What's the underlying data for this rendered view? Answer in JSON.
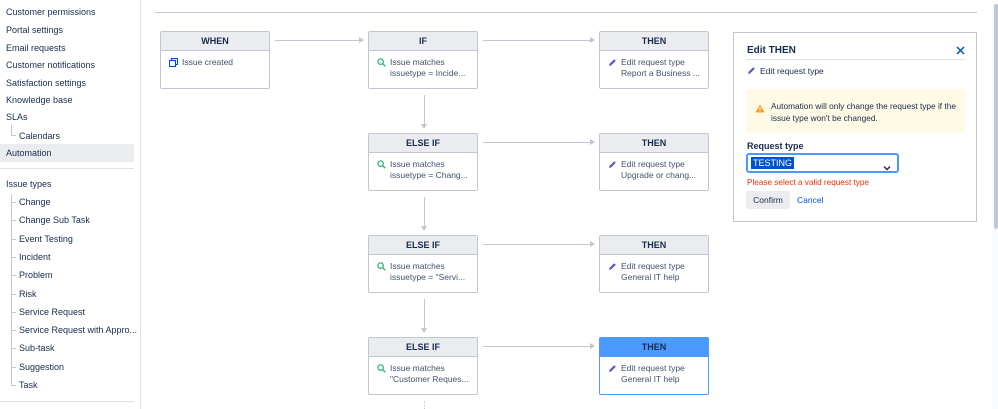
{
  "sidebar": {
    "top_items": [
      {
        "label": "Customer permissions"
      },
      {
        "label": "Portal settings"
      },
      {
        "label": "Email requests"
      },
      {
        "label": "Customer notifications"
      },
      {
        "label": "Satisfaction settings"
      },
      {
        "label": "Knowledge base"
      },
      {
        "label": "SLAs"
      },
      {
        "label": "Calendars"
      },
      {
        "label": "Automation",
        "active": true
      }
    ],
    "issue_types_label": "Issue types",
    "issue_types": [
      "Change",
      "Change Sub Task",
      "Event Testing",
      "Incident",
      "Problem",
      "Risk",
      "Service Request",
      "Service Request with Appro...",
      "Sub-task",
      "Suggestion",
      "Task"
    ]
  },
  "flow": {
    "when": {
      "header": "WHEN",
      "line1": "Issue created"
    },
    "rows": [
      {
        "cond": {
          "header": "IF",
          "line1": "Issue matches",
          "line2": "issuetype = Incide..."
        },
        "then": {
          "header": "THEN",
          "line1": "Edit request type",
          "line2": "Report a Business ..."
        }
      },
      {
        "cond": {
          "header": "ELSE IF",
          "line1": "Issue matches",
          "line2": "issuetype = Chang..."
        },
        "then": {
          "header": "THEN",
          "line1": "Edit request type",
          "line2": "Upgrade or chang..."
        }
      },
      {
        "cond": {
          "header": "ELSE IF",
          "line1": "Issue matches",
          "line2": "issuetype = \"Servi..."
        },
        "then": {
          "header": "THEN",
          "line1": "Edit request type",
          "line2": "General IT help"
        }
      },
      {
        "cond": {
          "header": "ELSE IF",
          "line1": "Issue matches",
          "line2": "\"Customer Reques..."
        },
        "then": {
          "header": "THEN",
          "line1": "Edit request type",
          "line2": "General IT help",
          "selected": true
        }
      }
    ]
  },
  "panel": {
    "title": "Edit THEN",
    "close_icon": "close-icon",
    "subtitle": "Edit request type",
    "warning": "Automation will only change the request type if the issue type won't be changed.",
    "field_label": "Request type",
    "field_value": "TESTING",
    "error": "Please select a valid request type",
    "confirm_label": "Confirm",
    "cancel_label": "Cancel"
  },
  "colors": {
    "accent": "#0052cc",
    "selected_header": "#4c9aff",
    "warning_bg": "#fffae6",
    "warning_icon": "#ff991f",
    "error": "#de350b",
    "search_icon": "#36b37e",
    "edit_icon": "#6554c0"
  }
}
